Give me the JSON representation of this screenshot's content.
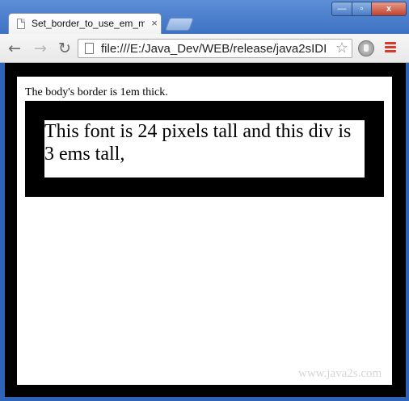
{
  "browser": {
    "tab_title": "Set_border_to_use_em_me",
    "tab_close": "×",
    "url": "file:///E:/Java_Dev/WEB/release/java2sIDI",
    "window_buttons": {
      "minimize": "—",
      "maximize": "▫",
      "close": "x"
    },
    "icons": {
      "back": "back-arrow-icon",
      "forward": "forward-arrow-icon",
      "reload": "reload-icon",
      "star": "bookmark-star-icon",
      "extension": "extension-icon",
      "menu": "menu-icon"
    }
  },
  "page": {
    "body_text": "The body's border is 1em thick.",
    "inner_text": "This font is 24 pixels tall and this div is 3 ems tall,",
    "watermark": "www.java2s.com"
  },
  "colors": {
    "border": "#000000",
    "background": "#ffffff",
    "menu_accent": "#d63b2a"
  }
}
